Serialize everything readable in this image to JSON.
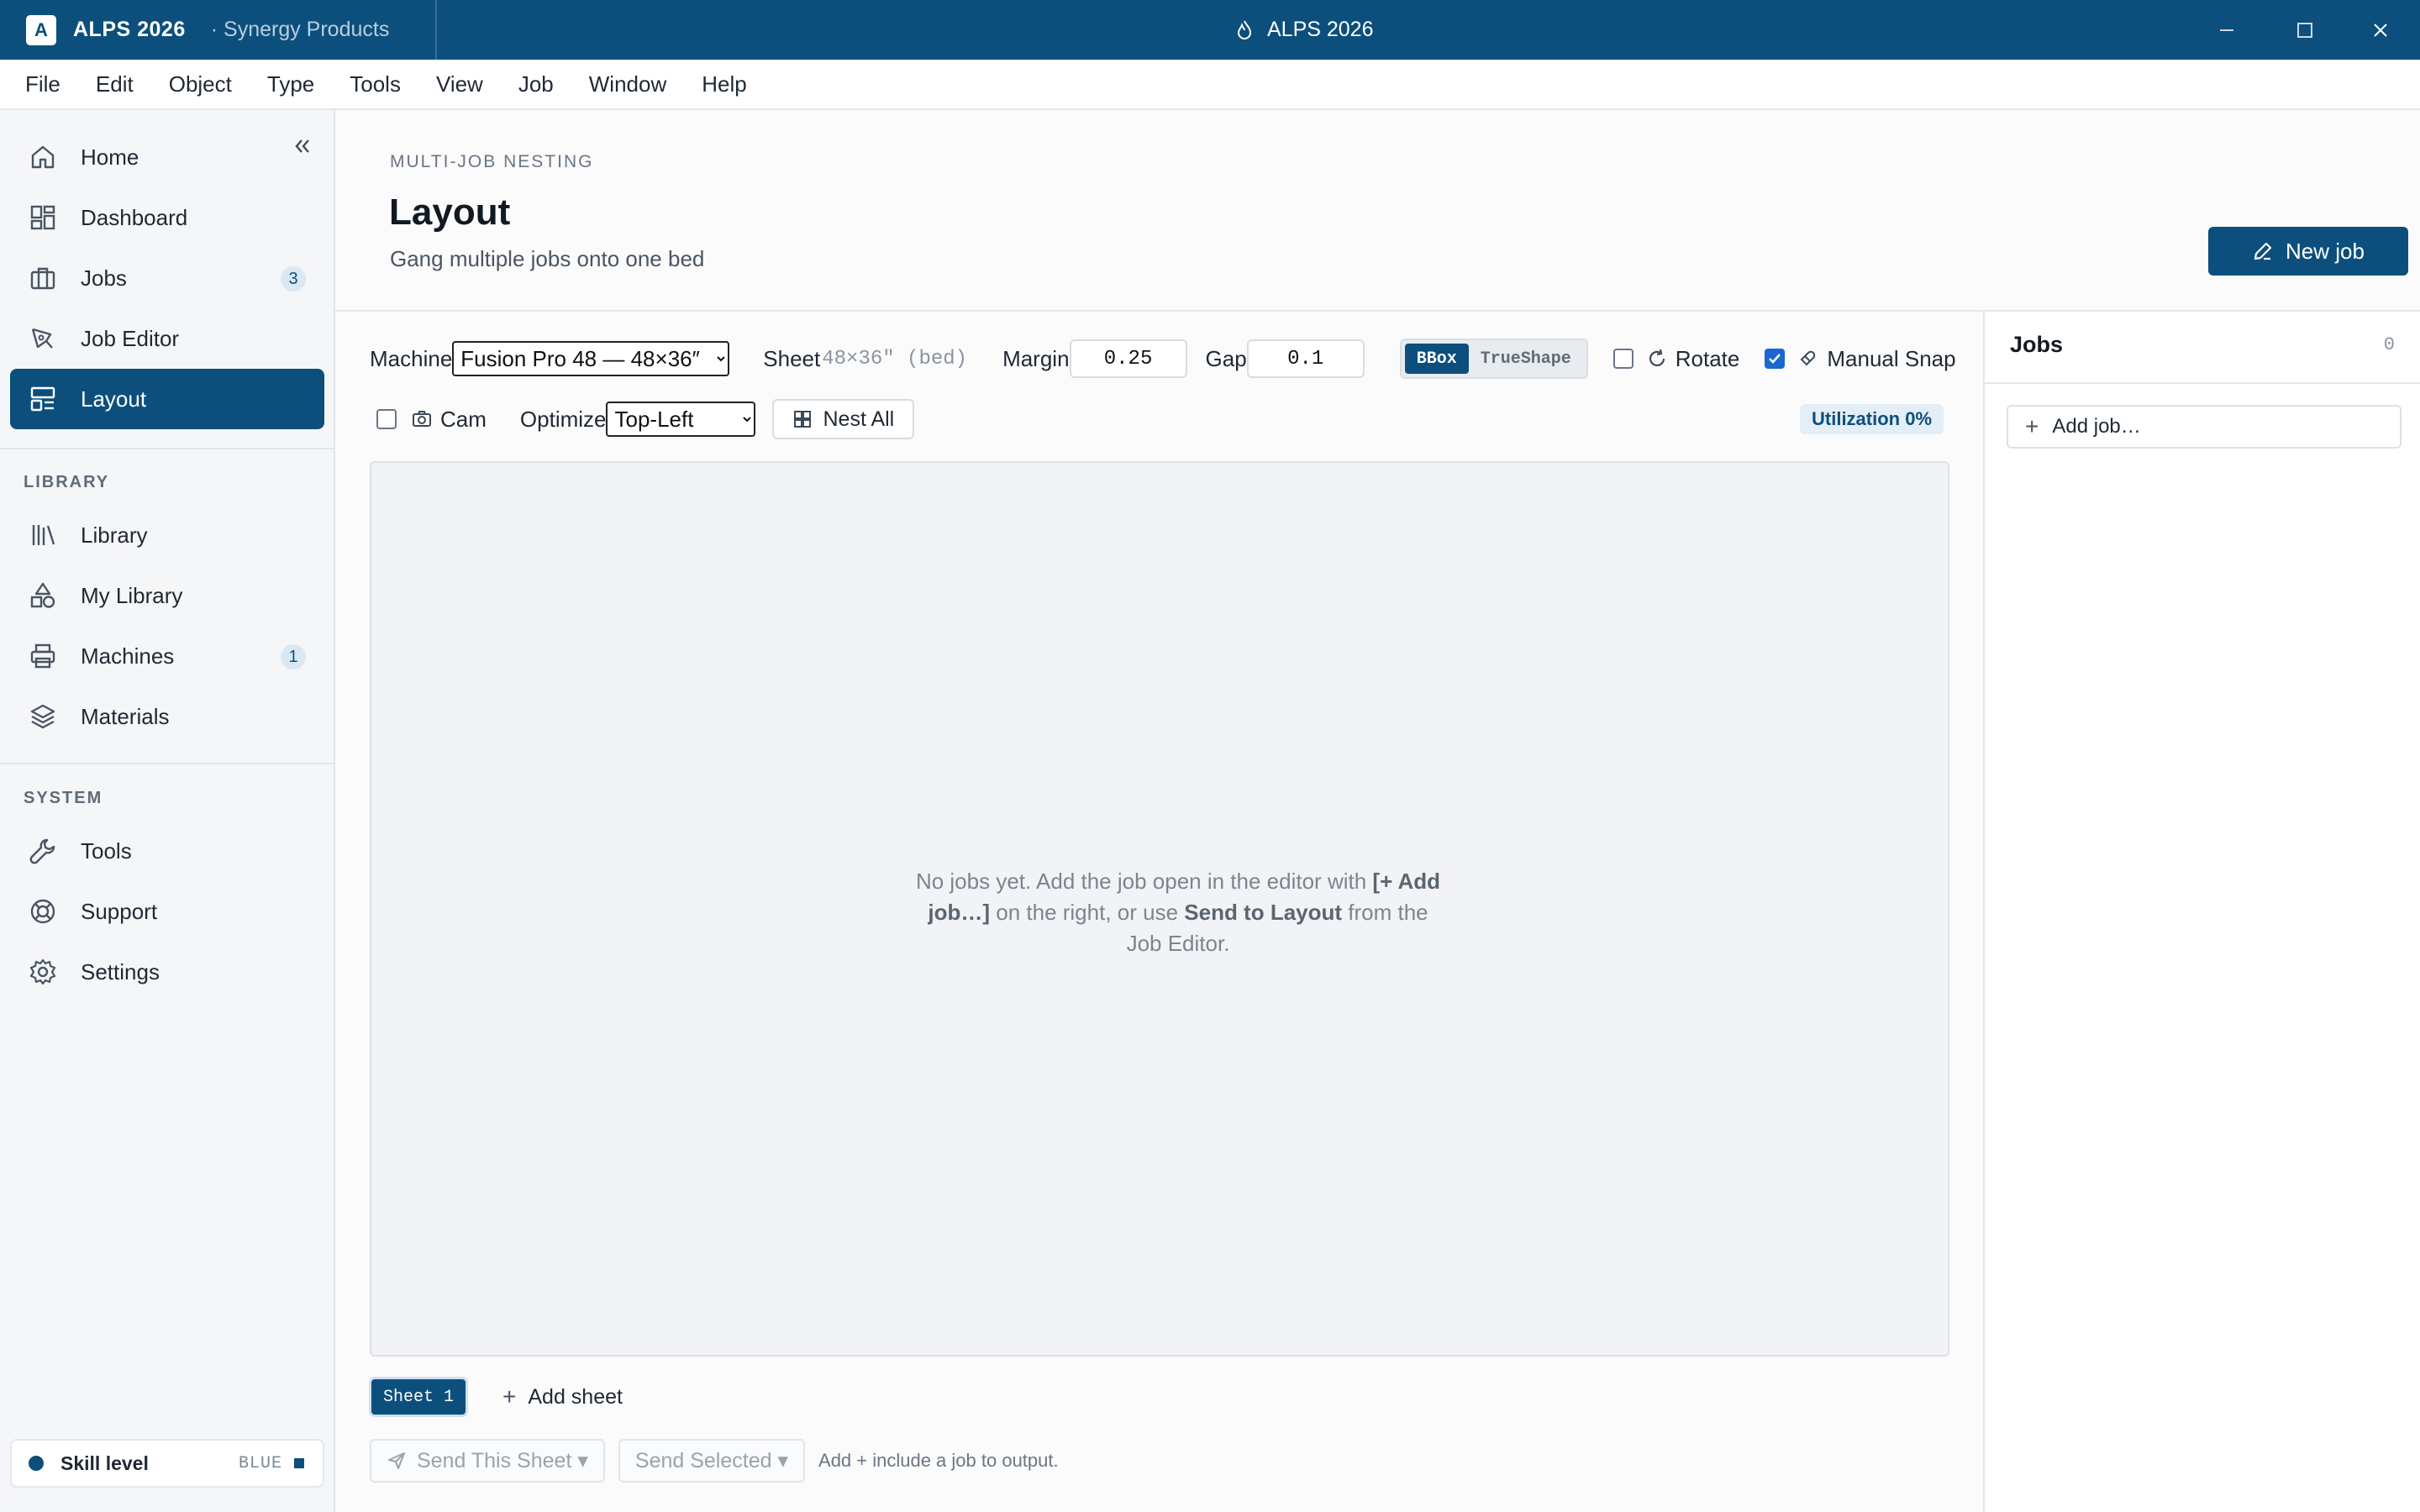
{
  "titlebar": {
    "logo_letter": "A",
    "app_name": "ALPS 2026",
    "org": "· Synergy Products",
    "window_title": "ALPS 2026",
    "icons": [
      "flame-icon",
      "minimize-icon",
      "maximize-icon",
      "close-icon"
    ]
  },
  "menu": [
    "File",
    "Edit",
    "Object",
    "Type",
    "Tools",
    "View",
    "Job",
    "Window",
    "Help"
  ],
  "sidebar": {
    "main": [
      {
        "label": "Home",
        "icon": "home-icon"
      },
      {
        "label": "Dashboard",
        "icon": "dashboard-icon"
      },
      {
        "label": "Jobs",
        "icon": "briefcase-icon",
        "badge": "3"
      },
      {
        "label": "Job Editor",
        "icon": "pen-tool-icon"
      },
      {
        "label": "Layout",
        "icon": "layout-icon",
        "active": true
      }
    ],
    "library_label": "LIBRARY",
    "library": [
      {
        "label": "Library",
        "icon": "library-icon"
      },
      {
        "label": "My Library",
        "icon": "shapes-icon"
      },
      {
        "label": "Machines",
        "icon": "printer-icon",
        "badge": "1"
      },
      {
        "label": "Materials",
        "icon": "layers-icon"
      }
    ],
    "system_label": "SYSTEM",
    "system": [
      {
        "label": "Tools",
        "icon": "wrench-icon"
      },
      {
        "label": "Support",
        "icon": "lifebuoy-icon"
      },
      {
        "label": "Settings",
        "icon": "gear-icon"
      }
    ],
    "skill": {
      "label": "Skill level",
      "level": "BLUE",
      "color": "#0d4f7c"
    }
  },
  "header": {
    "eyebrow": "MULTI-JOB NESTING",
    "title": "Layout",
    "subtitle": "Gang multiple jobs onto one bed",
    "new_job": "New job"
  },
  "toolbar": {
    "machine_label": "Machine",
    "machine_value": "Fusion Pro 48 — 48×36″",
    "sheet_label": "Sheet",
    "sheet_value": "48×36″ (bed)",
    "margin_label": "Margin",
    "margin_value": "0.25",
    "gap_label": "Gap",
    "gap_value": "0.1",
    "mode_bbox": "BBox",
    "mode_trueshape": "TrueShape",
    "mode_selected": "BBox",
    "rotate_label": "Rotate",
    "rotate_checked": false,
    "snap_label": "Manual Snap",
    "snap_checked": true,
    "cam_label": "Cam",
    "cam_checked": false,
    "optimize_label": "Optimize",
    "optimize_value": "Top-Left",
    "nest_all": "Nest All",
    "utilization": "Utilization 0%"
  },
  "canvas": {
    "empty_pre": "No jobs yet. Add the job open in the editor with ",
    "empty_add": "[+ Add job…]",
    "empty_mid": " on the right, or use ",
    "empty_send": "Send to Layout",
    "empty_post": " from the Job Editor."
  },
  "sheets": {
    "active": "Sheet 1",
    "add": "Add sheet"
  },
  "footer": {
    "send_sheet": "Send This Sheet ▾",
    "send_selected": "Send Selected ▾",
    "hint": "Add + include a job to output."
  },
  "jobs_panel": {
    "title": "Jobs",
    "count": "0",
    "add_job": "Add job…"
  },
  "colors": {
    "primary": "#0d4f7c",
    "accent_badge": "#d9e8f3",
    "checkbox": "#1a66d2"
  }
}
